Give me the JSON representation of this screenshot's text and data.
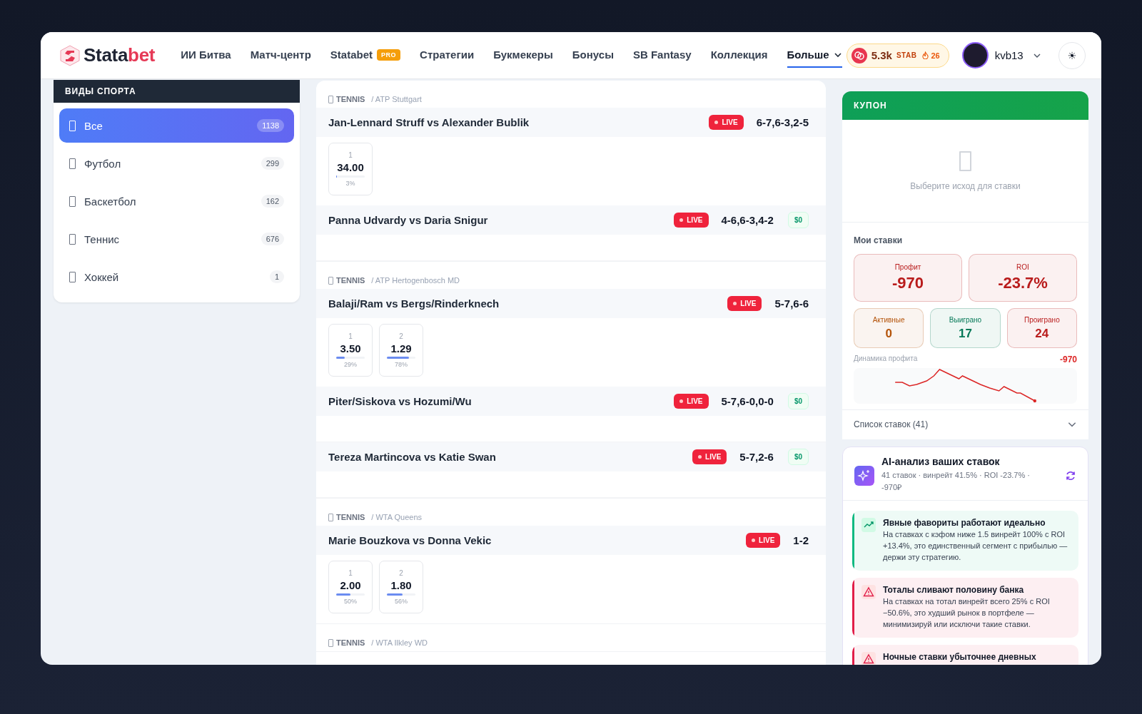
{
  "logo": {
    "name_start": "Stata",
    "name_end": "bet"
  },
  "nav": [
    {
      "label": "ИИ Битва",
      "selected": false,
      "dropdown": false
    },
    {
      "label": "Матч-центр",
      "selected": false,
      "dropdown": false
    },
    {
      "label": "Statabet",
      "badge": "PRO",
      "selected": false,
      "dropdown": false
    },
    {
      "label": "Стратегии",
      "selected": false,
      "dropdown": false
    },
    {
      "label": "Букмекеры",
      "selected": false,
      "dropdown": false
    },
    {
      "label": "Бонусы",
      "selected": false,
      "dropdown": false
    },
    {
      "label": "SB Fantasy",
      "selected": false,
      "dropdown": false
    },
    {
      "label": "Коллекция",
      "selected": false,
      "dropdown": false
    },
    {
      "label": "Больше",
      "selected": true,
      "dropdown": true
    }
  ],
  "balance": {
    "amount": "5.3k",
    "currency": "STAB",
    "streak": "26"
  },
  "user": {
    "name": "kvb13"
  },
  "theme_button": "☀",
  "sidebar": {
    "title": "ВИДЫ СПОРТА",
    "items": [
      {
        "label": "Все",
        "count": "1138",
        "selected": true
      },
      {
        "label": "Футбол",
        "count": "299",
        "selected": false
      },
      {
        "label": "Баскетбол",
        "count": "162",
        "selected": false
      },
      {
        "label": "Теннис",
        "count": "676",
        "selected": false
      },
      {
        "label": "Хоккей",
        "count": "1",
        "selected": false
      }
    ]
  },
  "groups": [
    {
      "sport": "TENNIS",
      "league": "/ ATP Stuttgart",
      "matches": [
        {
          "name": "Jan-Lennard Struff vs Alexander Bublik",
          "badge": "LIVE",
          "score": "6-7,6-3,2-5",
          "odds": [
            {
              "label": "1",
              "value": "34.00",
              "level": 0.03,
              "pct": "3%"
            }
          ]
        },
        {
          "name": "Panna Udvardy vs Daria Snigur",
          "badge": "LIVE",
          "score": "4-6,6-3,4-2",
          "stake": "$0"
        }
      ]
    },
    {
      "sport": "TENNIS",
      "league": "/ ATP Hertogenbosch MD",
      "matches": [
        {
          "name": "Balaji/Ram vs Bergs/Rinderknech",
          "badge": "LIVE",
          "score": "5-7,6-6",
          "odds": [
            {
              "label": "1",
              "value": "3.50",
              "level": 0.29,
              "pct": "29%"
            },
            {
              "label": "2",
              "value": "1.29",
              "level": 0.78,
              "pct": "78%"
            }
          ]
        },
        {
          "name": "Piter/Siskova vs Hozumi/Wu",
          "badge": "LIVE",
          "score": "5-7,6-0,0-0",
          "stake": "$0"
        },
        {
          "name": "Tereza Martincova vs Katie Swan",
          "badge": "LIVE",
          "score": "5-7,2-6",
          "stake": "$0"
        }
      ]
    },
    {
      "sport": "TENNIS",
      "league": "/ WTA Queens",
      "matches": [
        {
          "name": "Marie Bouzkova vs Donna Vekic",
          "badge": "LIVE",
          "score": "1-2",
          "odds": [
            {
              "label": "1",
              "value": "2.00",
              "level": 0.5,
              "pct": "50%"
            },
            {
              "label": "2",
              "value": "1.80",
              "level": 0.56,
              "pct": "56%"
            }
          ]
        }
      ]
    },
    {
      "sport": "TENNIS",
      "league": "/ WTA Ilkley WD"
    }
  ],
  "coupon": {
    "title": "КУПОН",
    "empty_text": "Выберите исход для ставки"
  },
  "my_bets": {
    "title": "Мои ставки",
    "main_stats": [
      {
        "label": "Профит",
        "value": "-970",
        "color": "#b91c1c"
      },
      {
        "label": "ROI",
        "value": "-23.7%",
        "color": "#b91c1c"
      }
    ],
    "stats": [
      {
        "label": "Активные",
        "value": "0",
        "color": "#b45309"
      },
      {
        "label": "Выиграно",
        "value": "17",
        "color": "#047857"
      },
      {
        "label": "Проиграно",
        "value": "24",
        "color": "#b91c1c"
      }
    ],
    "dynamics_label": "Динамика профита",
    "dynamics_value": "-970",
    "list_label": "Список ставок (41)"
  },
  "ai": {
    "title": "AI-анализ ваших ставок",
    "subtitle": "41 ставок · винрейт 41.5% · ROI -23.7% · -970₽",
    "insights": [
      {
        "kind": "trend",
        "color": "#10b981",
        "title": "Явные фавориты работают идеально",
        "text": "На ставках с кэфом ниже 1.5 винрейт 100% с ROI +13.4%, это единственный сегмент с прибылью — держи эту стратегию."
      },
      {
        "kind": "warning",
        "color": "#e11d48",
        "title": "Тоталы сливают половину банка",
        "text": "На ставках на тотал винрейт всего 25% с ROI −50.6%, это худший рынок в портфеле — минимизируй или исключи такие ставки."
      },
      {
        "kind": "warning",
        "color": "#e11d48",
        "title": "Ночные ставки убыточнее дневных"
      }
    ]
  }
}
